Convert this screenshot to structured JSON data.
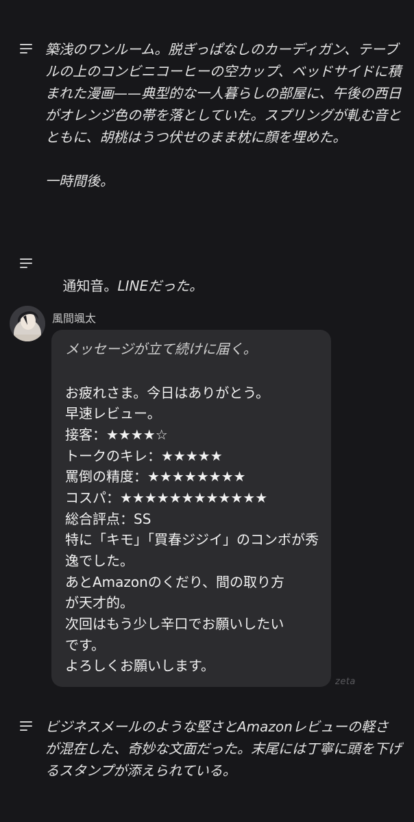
{
  "narrations": [
    {
      "text": "築浅のワンルーム。脱ぎっぱなしのカーディガン、テーブルの上のコンビニコーヒーの空カップ、ベッドサイドに積まれた漫画——典型的な一人暮らしの部屋に、午後の西日がオレンジ色の帯を落としていた。スプリングが軋む音とともに、胡桃はうつ伏せのまま枕に顔を埋めた。\n\n一時間後。"
    },
    {
      "text_plain": "通知音。",
      "text_italic": "LINEだった。"
    },
    {
      "text": "ビジネスメールのような堅さとAmazonレビューの軽さが混在した、奇妙な文面だった。末尾には丁寧に頭を下げるスタンプが添えられている。"
    }
  ],
  "message": {
    "sender": "風間颯太",
    "action": "メッセージが立て続けに届く。",
    "lines": [
      "お疲れさま。今日はありがとう。",
      "早速レビュー。",
      "接客：★★★★☆",
      "トークのキレ：★★★★★",
      "罵倒の精度：★★★★★★★★",
      "コスパ：★★★★★★★★★★★★",
      "総合評点：SS",
      "特に「キモ」「買春ジジイ」のコンボが秀",
      "逸でした。",
      "あとAmazonのくだり、間の取り方",
      "が天才的。",
      "次回はもう少し辛口でお願いしたい",
      "です。",
      "よろしくお願いします。"
    ]
  },
  "watermark": "zeta",
  "colors": {
    "background": "#17171a",
    "bubble": "#2c2c2f",
    "text": "#e4e4e4"
  },
  "icons": {
    "narration": "narration-lines-icon",
    "avatar": "character-avatar"
  }
}
